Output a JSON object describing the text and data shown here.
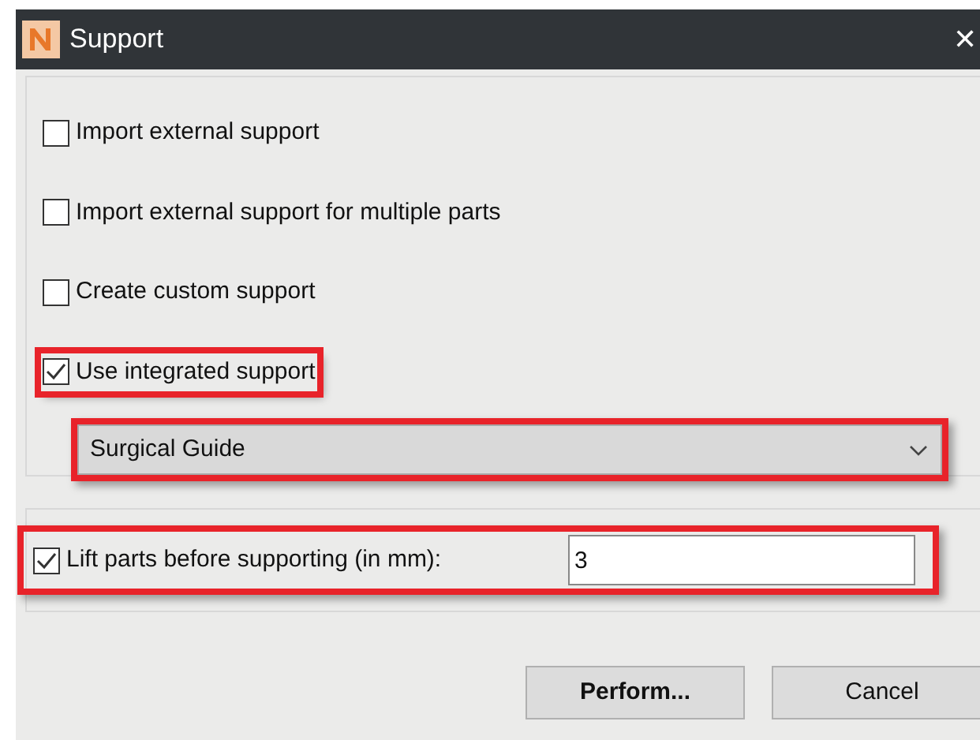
{
  "window": {
    "title": "Support",
    "close": "✕"
  },
  "options": [
    {
      "label": "Import external support",
      "checked": false,
      "highlighted": false
    },
    {
      "label": "Import external support for multiple parts",
      "checked": false,
      "highlighted": false
    },
    {
      "label": "Create custom support",
      "checked": false,
      "highlighted": false
    },
    {
      "label": "Use integrated support",
      "checked": true,
      "highlighted": true
    }
  ],
  "support_type": {
    "value": "Surgical Guide",
    "highlighted": true
  },
  "lift": {
    "label": "Lift parts before supporting (in mm):",
    "checked": true,
    "value": "3",
    "highlighted": true
  },
  "buttons": [
    {
      "label": "Perform...",
      "default": true
    },
    {
      "label": "Cancel",
      "default": false
    }
  ]
}
